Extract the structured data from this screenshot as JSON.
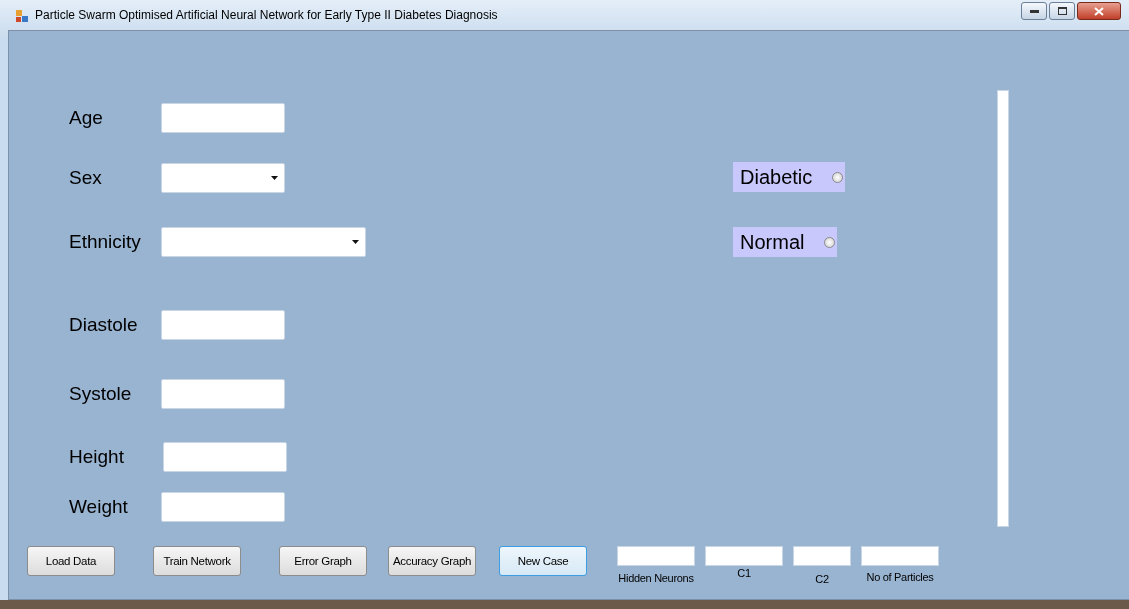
{
  "window": {
    "title": "Particle Swarm Optimised Artificial Neural Network for Early Type II Diabetes Diagnosis"
  },
  "fields": [
    {
      "label": "Age",
      "kind": "text"
    },
    {
      "label": "Sex",
      "kind": "dropdown"
    },
    {
      "label": "Ethnicity",
      "kind": "dropdown"
    },
    {
      "label": "Diastole",
      "kind": "text"
    },
    {
      "label": "Systole",
      "kind": "text"
    },
    {
      "label": "Height",
      "kind": "text"
    },
    {
      "label": "Weight",
      "kind": "text"
    }
  ],
  "outcomes": [
    {
      "label": "Diabetic",
      "selected": false
    },
    {
      "label": "Normal",
      "selected": false
    }
  ],
  "buttons": [
    {
      "label": "Load Data",
      "focused": false
    },
    {
      "label": "Train Network",
      "focused": false
    },
    {
      "label": "Error Graph",
      "focused": false
    },
    {
      "label": "Accuracy Graph",
      "focused": false
    },
    {
      "label": "New Case",
      "focused": true
    }
  ],
  "parameters": [
    {
      "label": "Hidden Neurons"
    },
    {
      "label": "C1"
    },
    {
      "label": "C2"
    },
    {
      "label": "No of Particles"
    }
  ]
}
